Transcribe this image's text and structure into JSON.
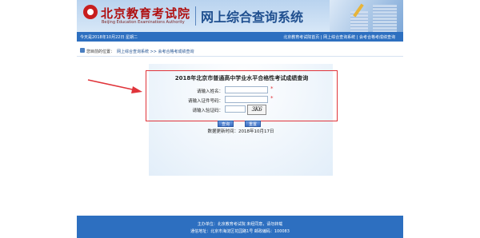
{
  "header": {
    "logo_cn": "北京教育考试院",
    "logo_en": "Beijing Education Examinations Authority",
    "site_title": "网上综合查询系统"
  },
  "navbar": {
    "date_text": "今天是2018年10月22日 星期二",
    "links": [
      "北京教育考试院首页",
      "网上综合查询系统",
      "会考合格考成绩查询"
    ],
    "separator": " | "
  },
  "breadcrumb": {
    "label": "您目前的位置：",
    "path": "网上综合查询系统 >> 会考合格考成绩查询"
  },
  "query": {
    "title": "2018年北京市普通高中学业水平合格性考试成绩查询",
    "name_label": "请输入姓名：",
    "name_value": "",
    "id_label": "请输入证件号码：",
    "id_value": "",
    "captcha_label": "请输入验证码：",
    "captcha_value": "",
    "captcha_text": "3K6",
    "required_mark": "*",
    "query_button": "查询",
    "reset_button": "重置",
    "update_text": "数据更新时间：2018年10月17日"
  },
  "footer": {
    "line1": "主办单位：北京教育考试院 未经同意，请勿转载",
    "line2": "通信地址：北京市海淀区花园路1号 邮政编码：100083"
  },
  "colors": {
    "nav_blue": "#2d6fc0",
    "highlight_red": "#e0343a",
    "header_light": "#cfe1f5"
  }
}
